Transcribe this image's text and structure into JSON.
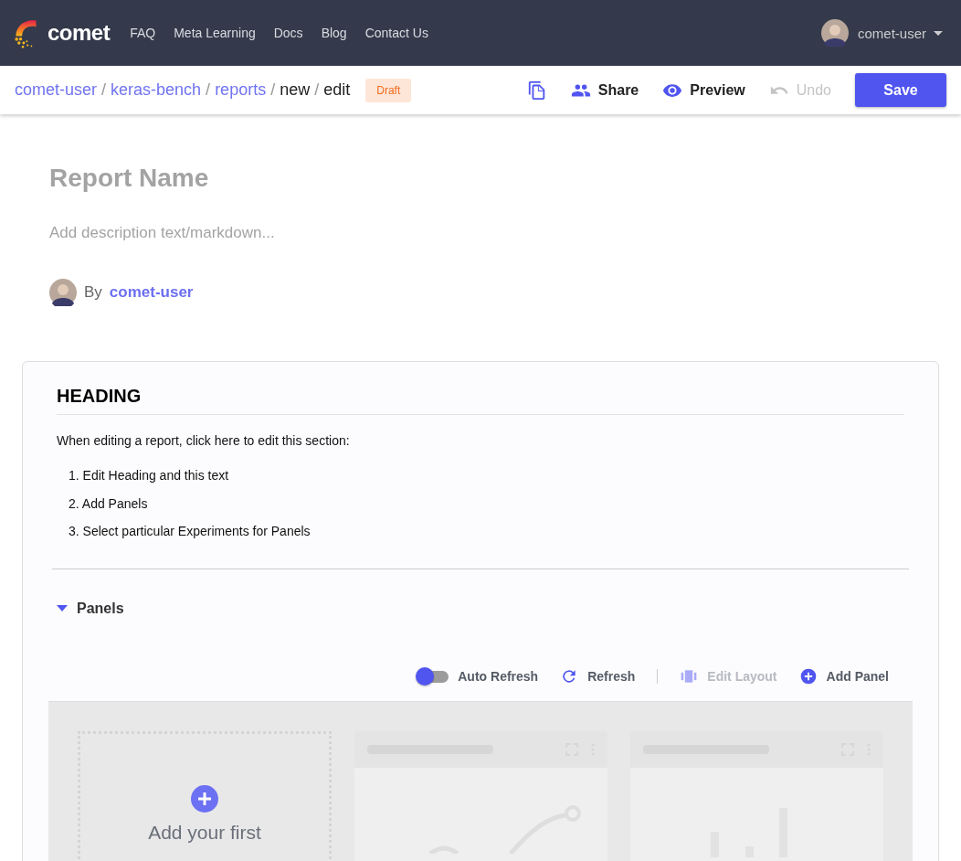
{
  "navbar": {
    "brand": "comet",
    "links": [
      "FAQ",
      "Meta Learning",
      "Docs",
      "Blog",
      "Contact Us"
    ],
    "user": "comet-user"
  },
  "toolbar": {
    "breadcrumb": [
      {
        "label": "comet-user",
        "link": true
      },
      {
        "label": "keras-bench",
        "link": true
      },
      {
        "label": "reports",
        "link": true
      },
      {
        "label": "new",
        "link": false
      },
      {
        "label": "edit",
        "link": false
      }
    ],
    "separator": "/",
    "badge": "Draft",
    "actions": [
      {
        "kind": "copy",
        "disabled": false
      },
      {
        "kind": "share",
        "label": "Share",
        "disabled": false
      },
      {
        "kind": "preview",
        "label": "Preview",
        "disabled": false
      },
      {
        "kind": "undo",
        "label": "Undo",
        "disabled": true
      }
    ],
    "save": "Save"
  },
  "report": {
    "name_placeholder": "Report Name",
    "description_placeholder": "Add description text/markdown...",
    "by": "By",
    "author": "comet-user"
  },
  "section": {
    "heading": "HEADING",
    "intro": "When editing a report, click here to edit this section:",
    "steps": [
      {
        "number": "1.",
        "text": "Edit Heading and this text"
      },
      {
        "number": "2.",
        "text": "Add Panels"
      },
      {
        "number": "3.",
        "text": "Select particular Experiments for Panels"
      }
    ],
    "panels": {
      "title": "Panels",
      "expanded": true,
      "auto_refresh": {
        "label": "Auto Refresh",
        "on": false
      },
      "tools": [
        {
          "kind": "refresh",
          "label": "Refresh",
          "disabled": false
        },
        {
          "kind": "layout",
          "label": "Edit Layout",
          "disabled": true
        },
        {
          "kind": "add",
          "label": "Add Panel",
          "disabled": false
        }
      ],
      "placeholder": "Add your first"
    }
  }
}
